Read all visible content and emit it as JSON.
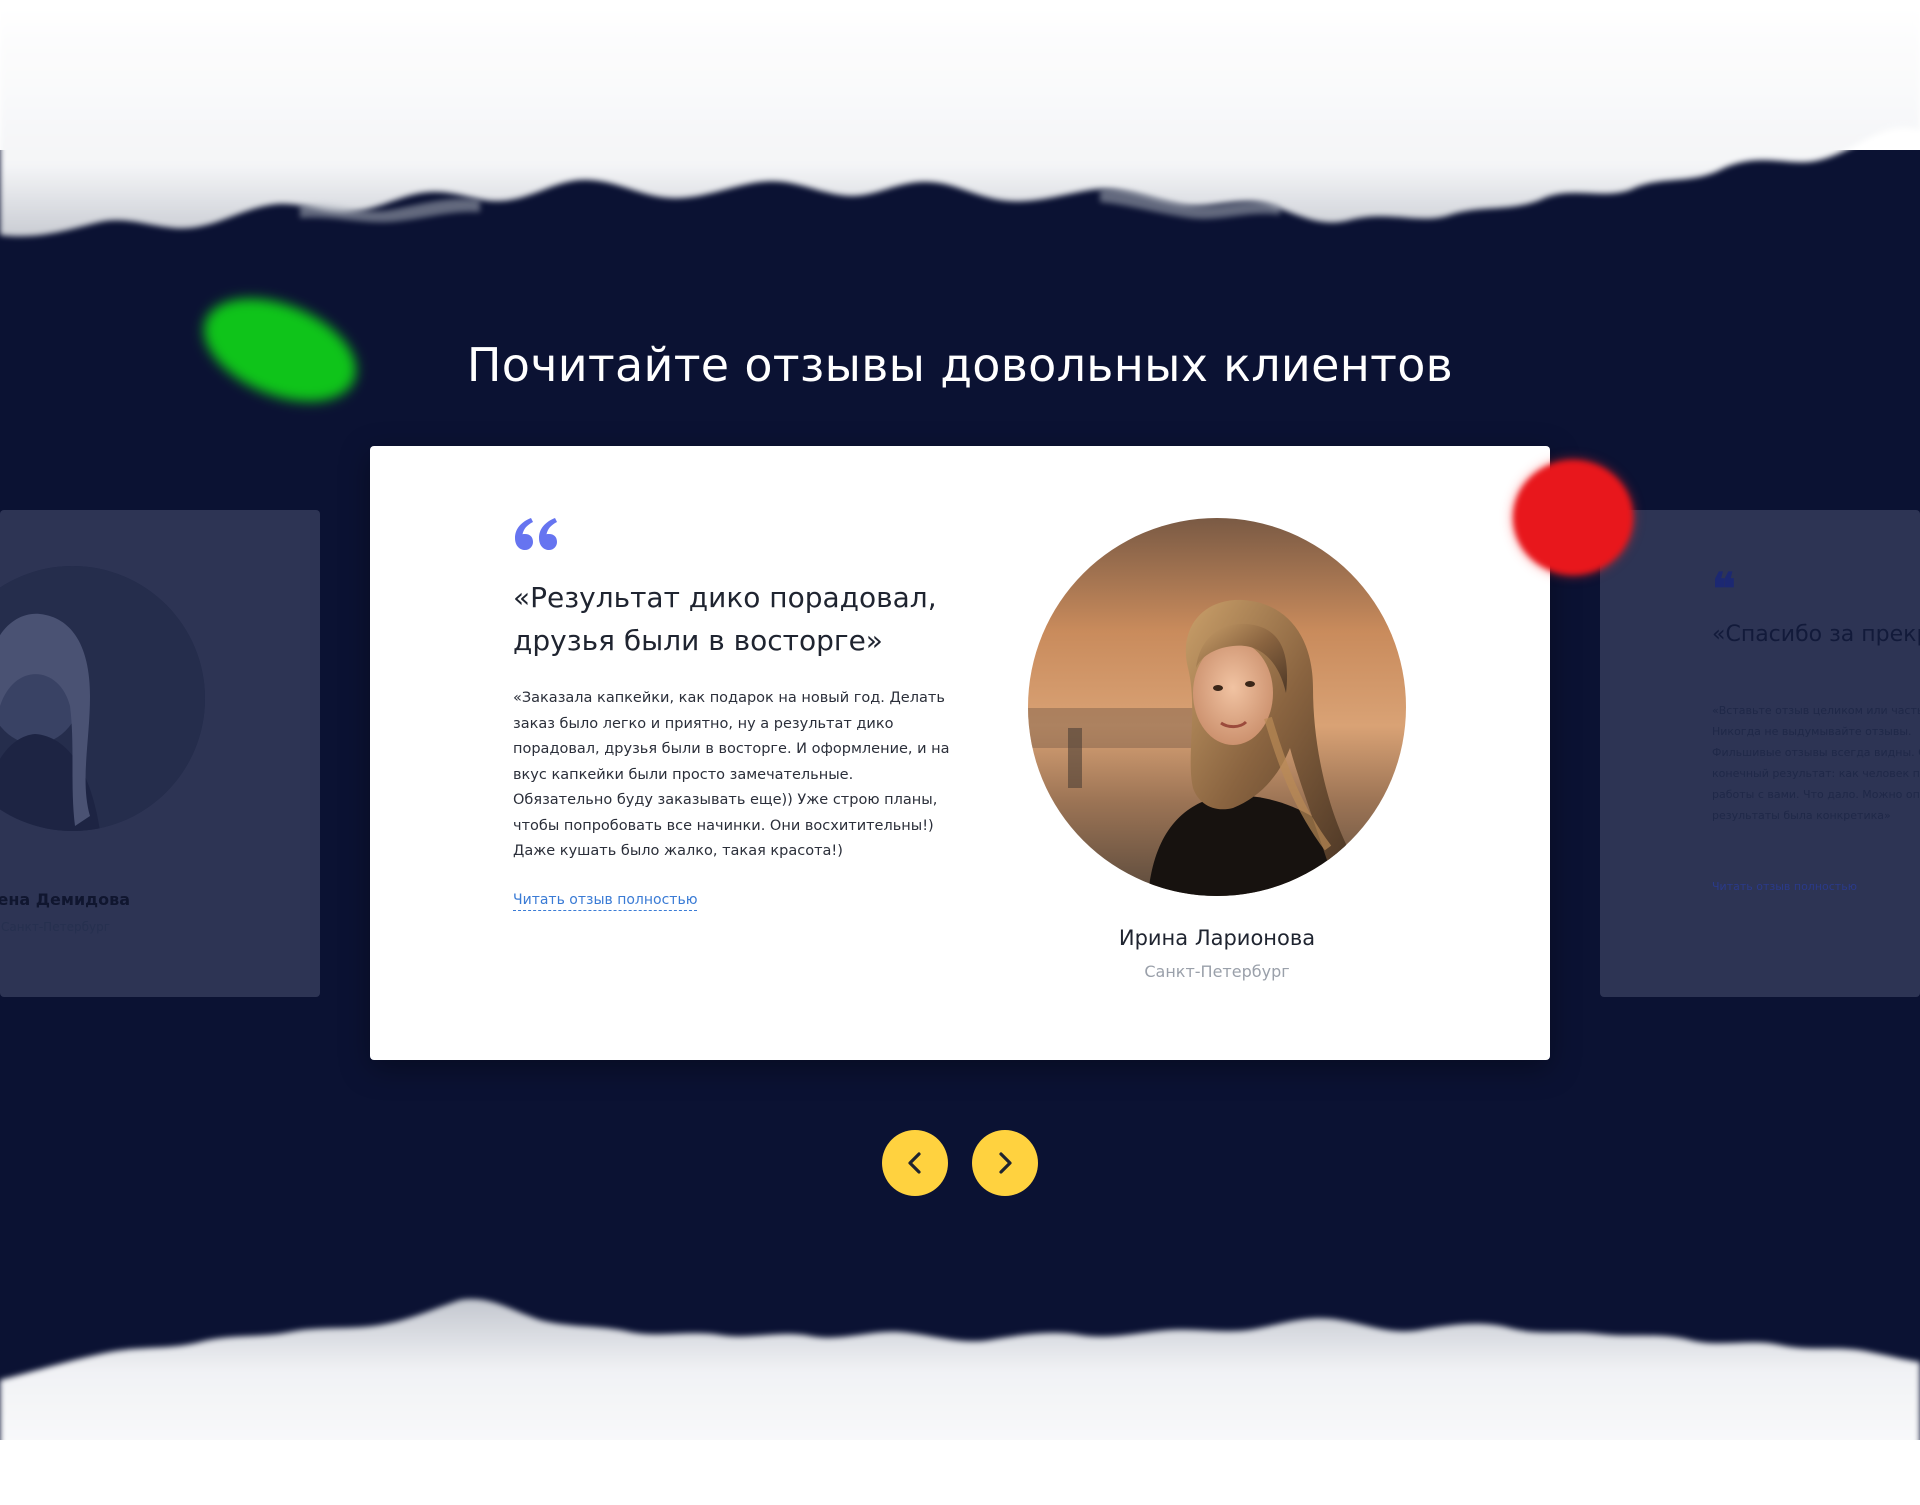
{
  "section": {
    "title": "Почитайте отзывы довольных клиентов"
  },
  "main_review": {
    "heading": "«Результат дико порадовал, друзья были в восторге»",
    "text": "«Заказала капкейки, как подарок на новый год. Делать заказ было легко и приятно, ну а результат дико порадовал, друзья были в восторге. И оформление, и на вкус капкейки были просто замечательные. Обязательно буду заказывать еще)) Уже строю планы, чтобы попробовать все начинки. Они восхитительны!) Даже кушать было жалко, такая красота!)",
    "read_more_label": "Читать отзыв полностью",
    "name": "Ирина Ларионова",
    "city": "Санкт-Петербург"
  },
  "left_review": {
    "name": "Елена Демидова",
    "city": "Санкт-Петербург"
  },
  "right_review": {
    "heading": "«Спасибо за прекрасные капкейки, все на",
    "text": "«Вставьте отзыв целиком или часть. Никогда не выдумывайте отзывы. Фильшивые отзывы всегда видны. Опишите конечный результат: как человек после работы с вами. Что дало. Можно описывать результаты была конкретика»",
    "read_more_label": "Читать отзыв полностью"
  },
  "navigation": {
    "prev_label": "‹",
    "next_label": "›"
  },
  "colors": {
    "background": "#0b1233",
    "accent_yellow": "#ffd23f",
    "quote_icon": "#6674f0",
    "link": "#3a7bd5"
  },
  "icons": [
    "quote-icon",
    "chevron-left-icon",
    "chevron-right-icon"
  ]
}
